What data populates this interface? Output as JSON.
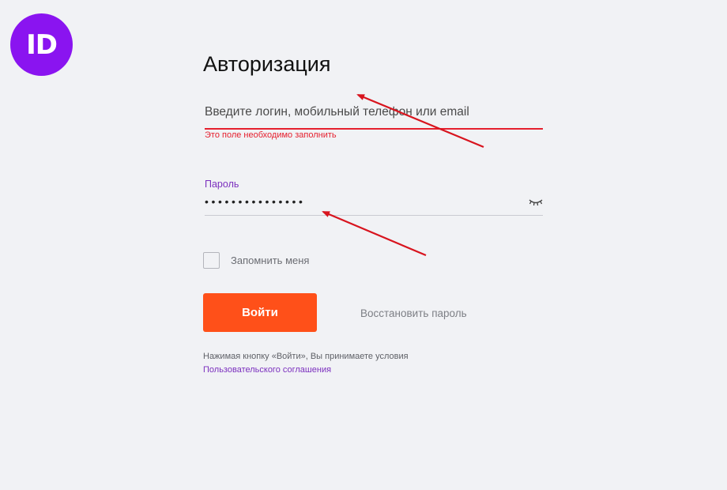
{
  "logo": {
    "text": "ID",
    "color": "#8a14f0"
  },
  "form": {
    "title": "Авторизация",
    "login": {
      "placeholder": "Введите логин, мобильный телефон или email",
      "value": "",
      "error": "Это поле необходимо заполнить"
    },
    "password": {
      "label": "Пароль",
      "masked_value": "•••••••••••••••",
      "toggle_icon": "eye-closed-icon"
    },
    "remember": {
      "label": "Запомнить меня",
      "checked": false
    },
    "submit_label": "Войти",
    "restore_label": "Восстановить пароль",
    "terms_text": "Нажимая кнопку «Войти», Вы принимаете условия",
    "terms_link": "Пользовательского соглашения"
  },
  "colors": {
    "accent": "#ff5019",
    "error": "#e5202e",
    "link": "#7b2fbe",
    "background": "#f1f2f5",
    "annotation_arrow": "#d8141e"
  }
}
